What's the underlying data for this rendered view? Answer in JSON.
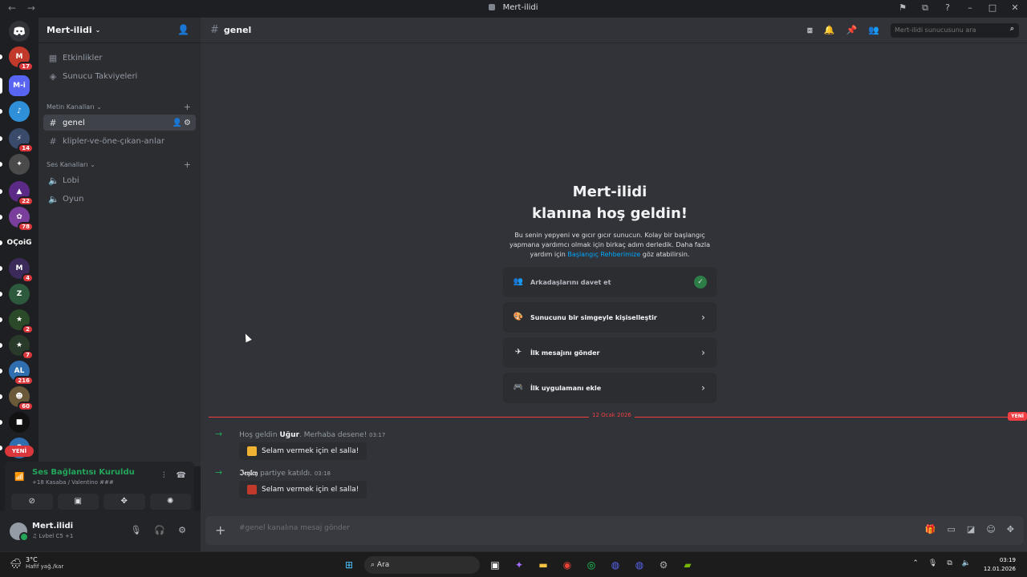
{
  "window": {
    "title": "Mert-ilidi",
    "nav_back": "←",
    "nav_forward": "→",
    "controls": [
      "⚑",
      "⧉",
      "?",
      "–",
      "□",
      "✕"
    ]
  },
  "server_rail": {
    "home_icon": "discord-logo",
    "servers": [
      {
        "label": "M",
        "badge": "17",
        "color": "#c0392b"
      },
      {
        "label": "M-i",
        "badge": "",
        "color": "#5865f2",
        "selected": true
      },
      {
        "label": "♪",
        "badge": "",
        "color": "#2f8fd8"
      },
      {
        "label": "⚡",
        "badge": "14",
        "color": "#3a4a6a"
      },
      {
        "label": "✦",
        "badge": "",
        "color": "#4a4a4a"
      },
      {
        "label": "▲",
        "badge": "22",
        "color": "#5b2a86"
      },
      {
        "label": "✿",
        "badge": "78",
        "color": "#7a3e9d"
      },
      {
        "label": "OÇoiG",
        "badge": "",
        "color": "#1e1f22"
      },
      {
        "label": "M",
        "badge": "4",
        "color": "#3b2a5a"
      },
      {
        "label": "Z",
        "badge": "",
        "color": "#2d5a3d"
      },
      {
        "label": "★",
        "badge": "2",
        "color": "#2a4a2a"
      },
      {
        "label": "★",
        "badge": "7",
        "color": "#2a3a2a"
      },
      {
        "label": "AL",
        "badge": "216",
        "color": "#2f6fb0"
      },
      {
        "label": "☻",
        "badge": "60",
        "color": "#6a5a3a"
      },
      {
        "label": "■",
        "badge": "",
        "color": "#111"
      },
      {
        "label": "S",
        "badge": "",
        "color": "#2f6fb0"
      }
    ],
    "new_label": "YENİ"
  },
  "sidebar": {
    "server_name": "Mert-ilidi",
    "top_items": [
      {
        "label": "Etkinlikler",
        "icon": "calendar-icon"
      },
      {
        "label": "Sunucu Takviyeleri",
        "icon": "boost-icon"
      }
    ],
    "text_category": "Metin Kanalları",
    "text_channels": [
      {
        "label": "genel",
        "active": true
      },
      {
        "label": "klipler-ve-öne-çıkan-anlar",
        "active": false
      }
    ],
    "voice_category": "Ses Kanalları",
    "voice_channels": [
      {
        "label": "Lobi"
      },
      {
        "label": "Oyun"
      }
    ]
  },
  "voice_panel": {
    "status": "Ses Bağlantısı Kuruldu",
    "detail": "+18 Kasaba / Valentino ###"
  },
  "user_panel": {
    "name": "Mert.ilidi",
    "status": "♫ Lvbel C5  +1"
  },
  "channel": {
    "name": "genel",
    "search_placeholder": "Mert-ilidi sunucusunu ara"
  },
  "welcome": {
    "title_line1": "Mert-ilidi",
    "title_line2": "klanına hoş geldin!",
    "desc_before_link": "Bu senin yepyeni ve gıcır gıcır sunucun. Kolay bir başlangıç yapmana yardımcı olmak için birkaç adım derledik. Daha fazla yardım için ",
    "link_text": "Başlangıç Rehberimize",
    "desc_after_link": " göz atabilirsin.",
    "cards": [
      {
        "label": "Arkadaşlarını davet et",
        "done": true
      },
      {
        "label": "Sunucunu bir simgeyle kişiselleştir",
        "done": false
      },
      {
        "label": "İlk mesajını gönder",
        "done": false
      },
      {
        "label": "İlk uygulamanı ekle",
        "done": false
      }
    ]
  },
  "messages": {
    "divider_date": "12 Ocak 2026",
    "divider_new": "YENİ",
    "items": [
      {
        "prefix": "Hoş geldin ",
        "user": "Uğur",
        "suffix": ". Merhaba desene!",
        "time": "03:17",
        "button": "Selam vermek için el salla!"
      },
      {
        "prefix": "",
        "user": "ℑ𝔢𝔶𝔩𝔠𝔶",
        "suffix": " partiye katıldı.",
        "time": "03:18",
        "button": "Selam vermek için el salla!"
      }
    ]
  },
  "composer": {
    "placeholder": "#genel kanalına mesaj gönder"
  },
  "taskbar": {
    "temperature": "3°C",
    "condition": "Hafif yağ./kar",
    "search": "Ara",
    "time": "03:19",
    "date": "12.01.2026"
  }
}
